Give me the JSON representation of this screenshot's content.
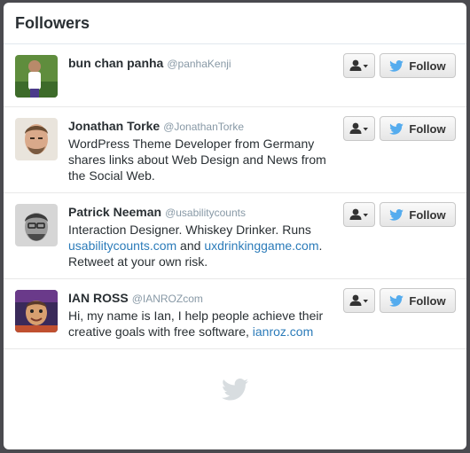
{
  "panel": {
    "title": "Followers"
  },
  "buttons": {
    "follow_label": "Follow"
  },
  "users": [
    {
      "name": "bun chan panha",
      "handle": "@panhaKenji",
      "bio": []
    },
    {
      "name": "Jonathan Torke",
      "handle": "@JonathanTorke",
      "bio": [
        {
          "type": "text",
          "text": "WordPress Theme Developer from Germany shares links about Web Design and News from the Social Web."
        }
      ]
    },
    {
      "name": "Patrick Neeman",
      "handle": "@usabilitycounts",
      "bio": [
        {
          "type": "text",
          "text": "Interaction Designer. Whiskey Drinker. Runs "
        },
        {
          "type": "link",
          "text": "usabilitycounts.com"
        },
        {
          "type": "text",
          "text": " and "
        },
        {
          "type": "link",
          "text": "uxdrinkinggame.com"
        },
        {
          "type": "text",
          "text": ". Retweet at your own risk."
        }
      ]
    },
    {
      "name": "IAN ROSS",
      "handle": "@IANROZcom",
      "bio": [
        {
          "type": "text",
          "text": "Hi, my name is Ian, I help people achieve their creative goals with free software, "
        },
        {
          "type": "link",
          "text": "ianroz.com"
        }
      ]
    }
  ],
  "colors": {
    "link": "#2b7bb9",
    "twitter_blue": "#55acee",
    "footer_bird": "#d8dde0",
    "window_bg": "#4a4a4f"
  },
  "icons": {
    "menu": "user-icon",
    "dropdown": "caret-down-icon",
    "follow": "twitter-bird-icon",
    "footer": "twitter-bird-icon"
  }
}
